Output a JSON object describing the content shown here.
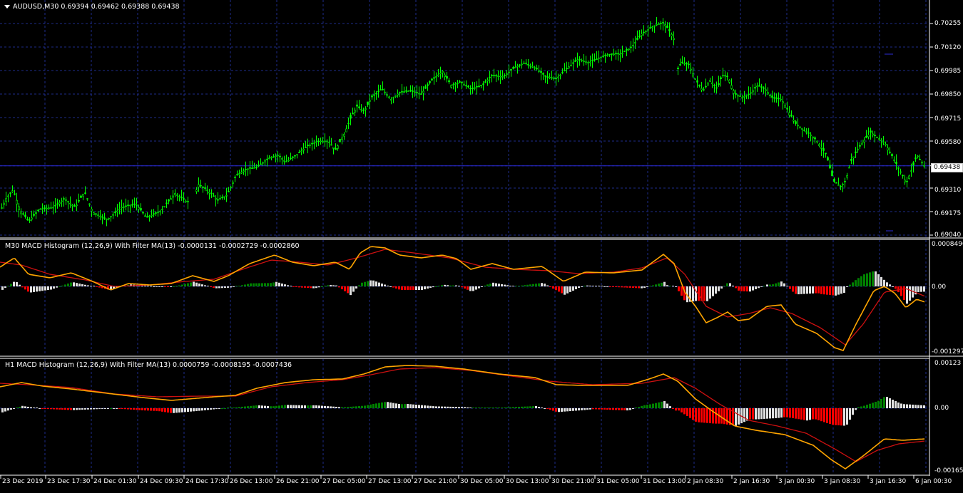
{
  "main": {
    "title": "AUDUSD,M30  0.69394 0.69462 0.69388 0.69438",
    "price_ticks": [
      "0.70255",
      "0.70120",
      "0.69985",
      "0.69850",
      "0.69715",
      "0.69580",
      "0.69310",
      "0.69175",
      "0.69040"
    ],
    "current_price": "0.69438",
    "colors": {
      "candle": "#00ff00",
      "grid": "#1e2b8a",
      "background": "#000000",
      "price_line": "#2b2bd6"
    }
  },
  "macd_m30": {
    "title": "M30 MACD Histogram (12,26,9) With Filter MA(13) -0.0000131 -0.0002729 -0.0002860",
    "ticks": [
      "0.0008496",
      "0.00",
      "-0.0012978"
    ]
  },
  "macd_h1": {
    "title": "H1 MACD Histogram (12,26,9) With Filter MA(13) 0.0000759 -0.0008195 -0.0007436",
    "ticks": [
      "0.00123",
      "0.00",
      "-0.001658"
    ]
  },
  "time_axis": [
    "23 Dec 2019",
    "23 Dec 17:30",
    "24 Dec 01:30",
    "24 Dec 09:30",
    "24 Dec 17:30",
    "26 Dec 13:00",
    "26 Dec 21:00",
    "27 Dec 05:00",
    "27 Dec 13:00",
    "27 Dec 21:00",
    "30 Dec 05:00",
    "30 Dec 13:00",
    "30 Dec 21:00",
    "31 Dec 05:00",
    "31 Dec 13:00",
    "2 Jan 08:30",
    "2 Jan 16:30",
    "3 Jan 00:30",
    "3 Jan 08:30",
    "3 Jan 16:30",
    "6 Jan 00:30"
  ],
  "chart_data": [
    {
      "type": "candlestick",
      "title": "AUDUSD,M30",
      "ylim": [
        0.6904,
        0.703
      ],
      "close_path": [
        [
          0,
          0.6918
        ],
        [
          8,
          0.6925
        ],
        [
          18,
          0.693
        ],
        [
          28,
          0.6918
        ],
        [
          40,
          0.6912
        ],
        [
          55,
          0.6919
        ],
        [
          75,
          0.692
        ],
        [
          90,
          0.6925
        ],
        [
          105,
          0.692
        ],
        [
          118,
          0.6929
        ],
        [
          130,
          0.6917
        ],
        [
          150,
          0.6913
        ],
        [
          170,
          0.692
        ],
        [
          190,
          0.6922
        ],
        [
          205,
          0.6914
        ],
        [
          225,
          0.6918
        ],
        [
          245,
          0.6928
        ],
        [
          262,
          0.6923
        ],
        [
          270,
          0.6925
        ],
        [
          278,
          0.6933
        ],
        [
          290,
          0.693
        ],
        [
          305,
          0.6924
        ],
        [
          318,
          0.6927
        ],
        [
          330,
          0.6938
        ],
        [
          345,
          0.6942
        ],
        [
          360,
          0.6943
        ],
        [
          375,
          0.6948
        ],
        [
          390,
          0.695
        ],
        [
          400,
          0.6946
        ],
        [
          415,
          0.695
        ],
        [
          430,
          0.6955
        ],
        [
          445,
          0.6958
        ],
        [
          460,
          0.6958
        ],
        [
          470,
          0.6953
        ],
        [
          482,
          0.6962
        ],
        [
          492,
          0.6972
        ],
        [
          500,
          0.6978
        ],
        [
          510,
          0.6975
        ],
        [
          520,
          0.6983
        ],
        [
          535,
          0.6988
        ],
        [
          548,
          0.6982
        ],
        [
          560,
          0.6986
        ],
        [
          575,
          0.6987
        ],
        [
          590,
          0.6985
        ],
        [
          605,
          0.6993
        ],
        [
          620,
          0.6998
        ],
        [
          632,
          0.699
        ],
        [
          645,
          0.6992
        ],
        [
          660,
          0.6988
        ],
        [
          675,
          0.699
        ],
        [
          690,
          0.6996
        ],
        [
          705,
          0.6995
        ],
        [
          720,
          0.7
        ],
        [
          735,
          0.7003
        ],
        [
          750,
          0.7
        ],
        [
          765,
          0.6995
        ],
        [
          780,
          0.6994
        ],
        [
          795,
          0.7
        ],
        [
          810,
          0.7005
        ],
        [
          825,
          0.7003
        ],
        [
          840,
          0.7006
        ],
        [
          855,
          0.7008
        ],
        [
          870,
          0.7008
        ],
        [
          885,
          0.7012
        ],
        [
          900,
          0.702
        ],
        [
          912,
          0.7023
        ],
        [
          920,
          0.7025
        ],
        [
          930,
          0.7026
        ],
        [
          940,
          0.702
        ],
        [
          944,
          0.7017
        ],
        [
          948,
          0.6998
        ],
        [
          955,
          0.7003
        ],
        [
          965,
          0.7002
        ],
        [
          975,
          0.6993
        ],
        [
          985,
          0.6987
        ],
        [
          995,
          0.6993
        ],
        [
          1005,
          0.6988
        ],
        [
          1012,
          0.6996
        ],
        [
          1020,
          0.6995
        ],
        [
          1030,
          0.6985
        ],
        [
          1040,
          0.6983
        ],
        [
          1050,
          0.6985
        ],
        [
          1062,
          0.699
        ],
        [
          1072,
          0.6988
        ],
        [
          1082,
          0.6983
        ],
        [
          1095,
          0.6982
        ],
        [
          1105,
          0.6975
        ],
        [
          1115,
          0.6968
        ],
        [
          1125,
          0.6965
        ],
        [
          1135,
          0.6962
        ],
        [
          1145,
          0.6958
        ],
        [
          1158,
          0.695
        ],
        [
          1168,
          0.6935
        ],
        [
          1178,
          0.6932
        ],
        [
          1185,
          0.6935
        ],
        [
          1192,
          0.6946
        ],
        [
          1200,
          0.6952
        ],
        [
          1210,
          0.6958
        ],
        [
          1220,
          0.6963
        ],
        [
          1230,
          0.696
        ],
        [
          1240,
          0.6957
        ],
        [
          1252,
          0.6948
        ],
        [
          1260,
          0.6942
        ],
        [
          1270,
          0.6934
        ],
        [
          1278,
          0.6942
        ],
        [
          1285,
          0.695
        ],
        [
          1295,
          0.6944
        ]
      ]
    },
    {
      "type": "bar",
      "title": "M30 MACD Histogram (12,26,9) With Filter MA(13)",
      "ylim": [
        -0.0012978,
        0.0008496
      ]
    },
    {
      "type": "bar",
      "title": "H1 MACD Histogram (12,26,9) With Filter MA(13)",
      "ylim": [
        -0.001658,
        0.00123
      ]
    }
  ]
}
